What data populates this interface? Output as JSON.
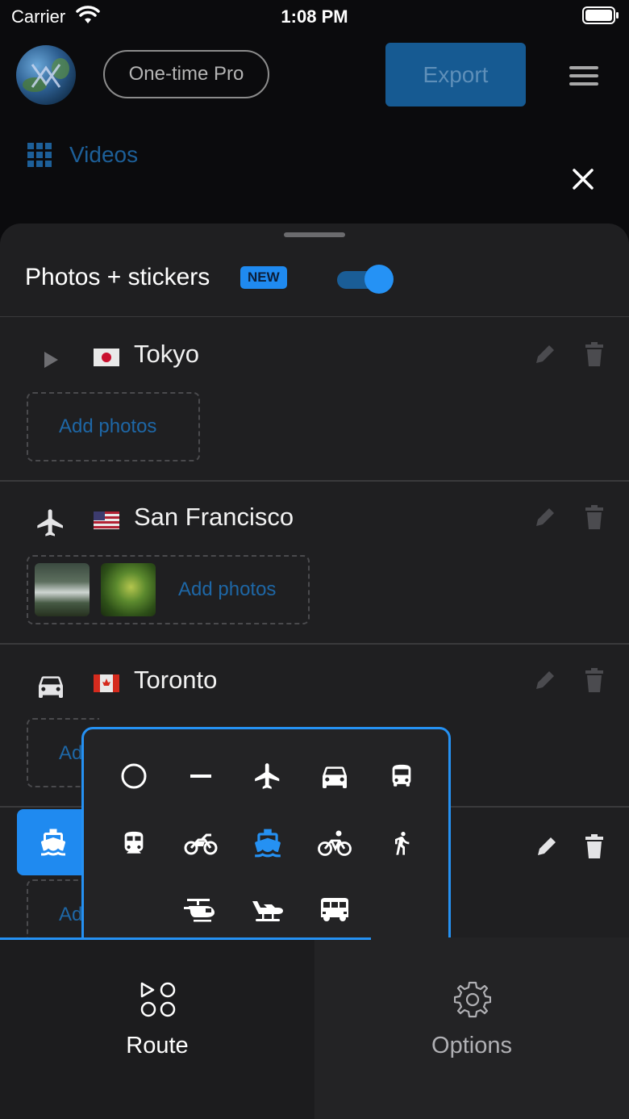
{
  "status_bar": {
    "carrier": "Carrier",
    "time": "1:08 PM"
  },
  "header": {
    "pro_label": "One-time Pro",
    "export_label": "Export",
    "videos_label": "Videos"
  },
  "sheet": {
    "title": "Photos + stickers",
    "badge": "NEW",
    "toggle_on": true
  },
  "stops": [
    {
      "city": "Tokyo",
      "mode_icon": "play-icon",
      "flag": "japan-flag",
      "add_label": "Add photos",
      "photo_count": 0
    },
    {
      "city": "San Francisco",
      "mode_icon": "airplane-icon",
      "flag": "usa-flag",
      "add_label": "Add photos",
      "photo_count": 2
    },
    {
      "city": "Toronto",
      "mode_icon": "car-icon",
      "flag": "canada-flag",
      "add_label": "Ad",
      "photo_count": 0
    },
    {
      "city": "",
      "mode_icon": "ferry-icon",
      "flag": "",
      "add_label": "Ad",
      "photo_count": 0
    }
  ],
  "transport_modes": [
    "circle-icon",
    "line-icon",
    "airplane-icon",
    "car-icon",
    "bus-icon",
    "train-icon",
    "motorcycle-icon",
    "ferry-icon",
    "bicycle-icon",
    "running-icon",
    "helicopter-icon",
    "seaplane-icon",
    "van-icon"
  ],
  "selected_mode": "ferry-icon",
  "tabs": [
    {
      "label": "Route",
      "icon": "route-icon",
      "active": true
    },
    {
      "label": "Options",
      "icon": "gear-icon",
      "active": false
    }
  ],
  "colors": {
    "accent": "#2591f3",
    "export_bg": "#165a92",
    "sheet_bg": "#1f1f21"
  }
}
